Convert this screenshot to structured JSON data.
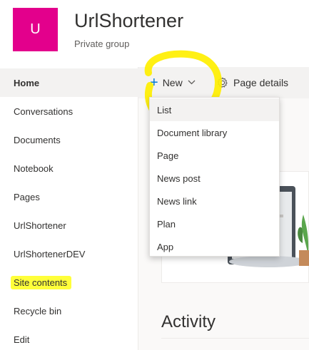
{
  "site": {
    "logo_letter": "U",
    "title": "UrlShortener",
    "subtitle": "Private group",
    "logo_color": "#e3008c"
  },
  "sidebar": {
    "items": [
      {
        "label": "Home",
        "active": true
      },
      {
        "label": "Conversations"
      },
      {
        "label": "Documents"
      },
      {
        "label": "Notebook"
      },
      {
        "label": "Pages"
      },
      {
        "label": "UrlShortener"
      },
      {
        "label": "UrlShortenerDEV"
      },
      {
        "label": "Site contents",
        "highlighted": true
      },
      {
        "label": "Recycle bin"
      },
      {
        "label": "Edit"
      }
    ]
  },
  "command_bar": {
    "new_label": "New",
    "new_icon": "plus-icon",
    "chevron_icon": "chevron-down-icon",
    "page_details_label": "Page details",
    "page_details_icon": "gear-icon"
  },
  "new_menu": {
    "items": [
      {
        "label": "List",
        "active": true
      },
      {
        "label": "Document library"
      },
      {
        "label": "Page"
      },
      {
        "label": "News post"
      },
      {
        "label": "News link"
      },
      {
        "label": "Plan"
      },
      {
        "label": "App"
      }
    ]
  },
  "main": {
    "activity_title": "Activity"
  },
  "colors": {
    "accent": "#0078d4",
    "highlight": "#ffff3a"
  }
}
